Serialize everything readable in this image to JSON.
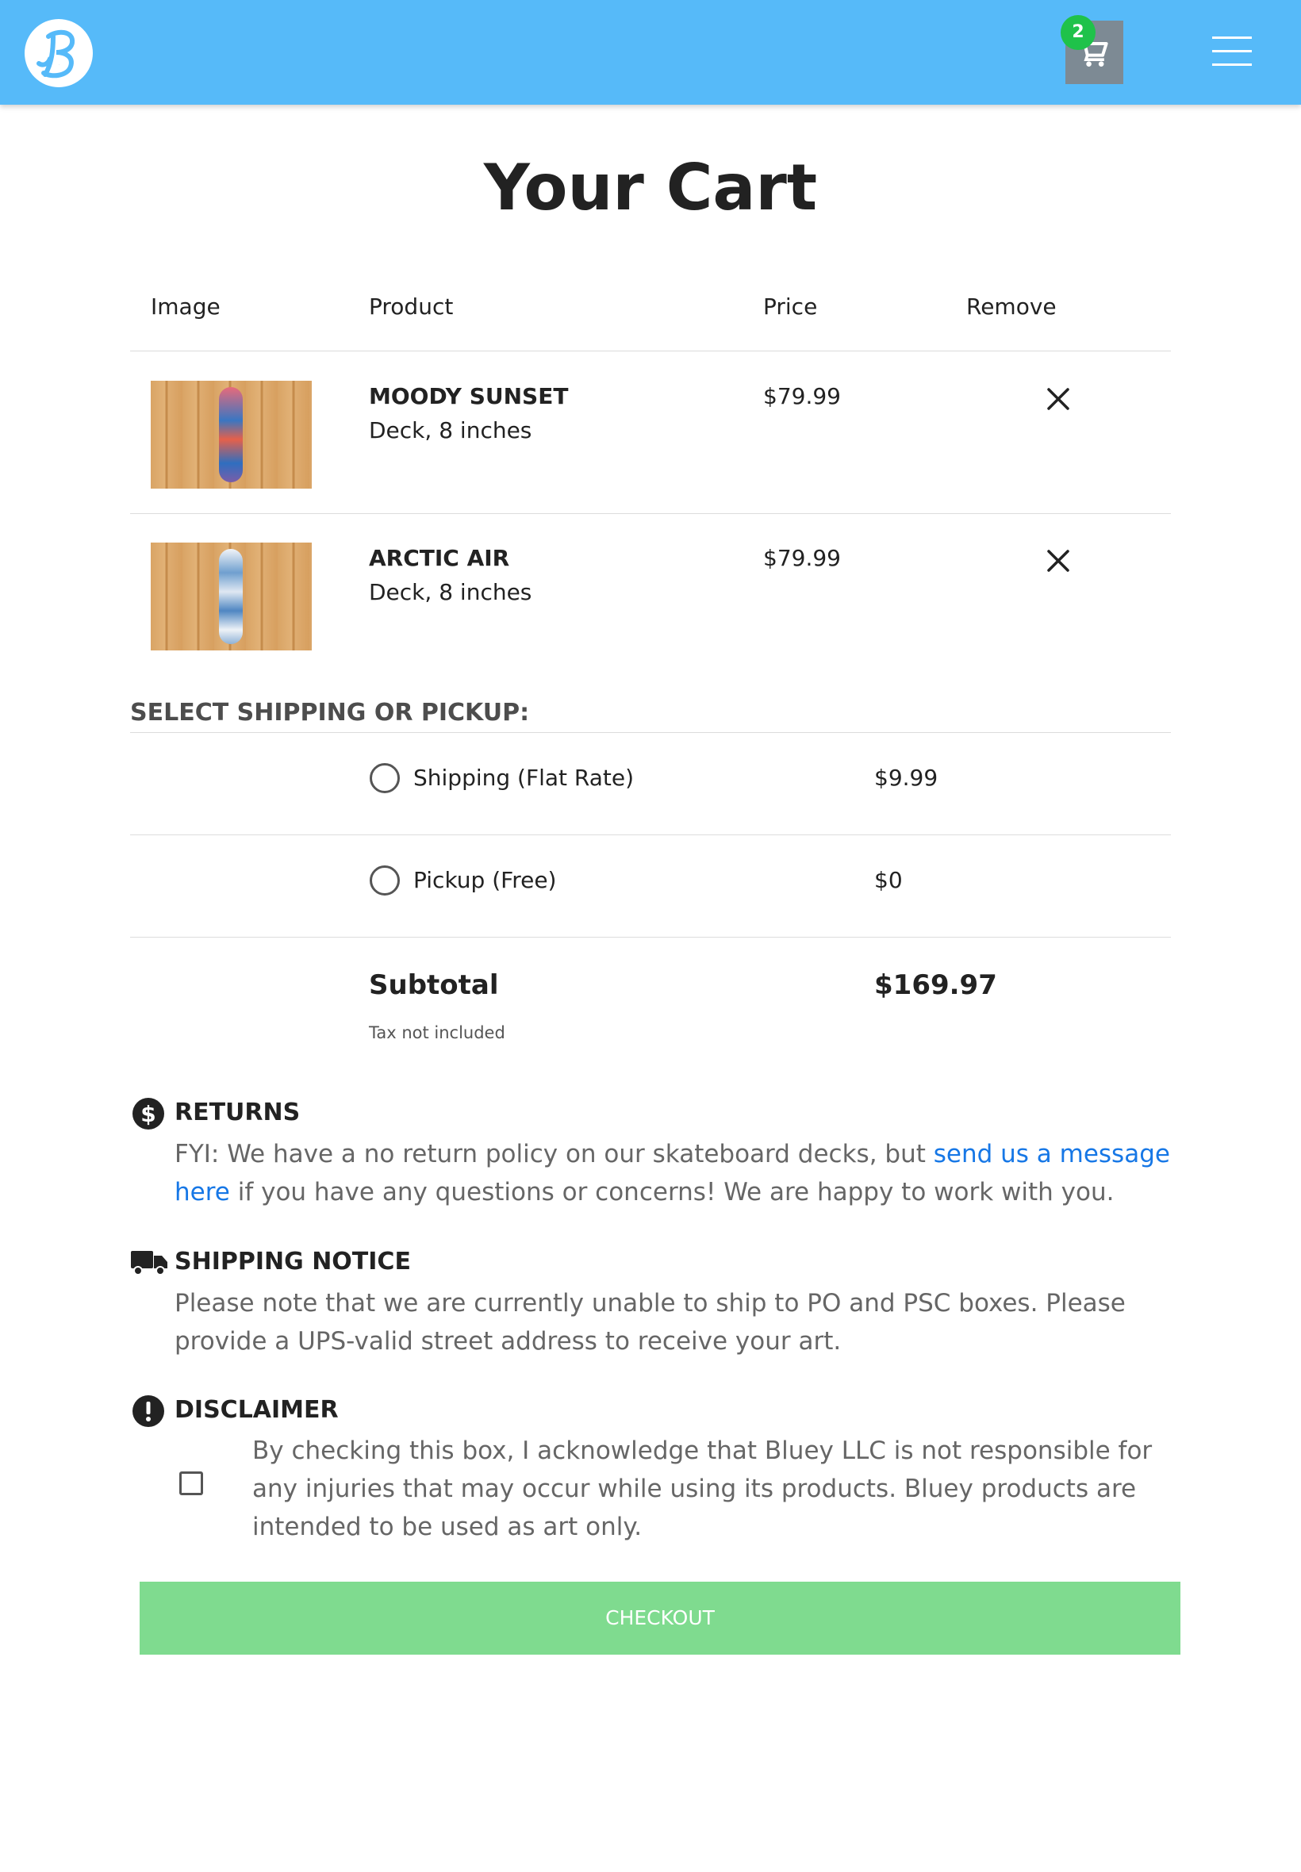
{
  "header": {
    "logo_letter": "B",
    "cart_count": "2",
    "colors": {
      "bar": "#56baf9",
      "cart_button": "#7d8a94",
      "badge": "#1fc24a"
    }
  },
  "page_title": "Your Cart",
  "table": {
    "headers": {
      "image": "Image",
      "product": "Product",
      "price": "Price",
      "remove": "Remove"
    },
    "items": [
      {
        "name": "MOODY SUNSET",
        "variant": "Deck, 8 inches",
        "price": "$79.99",
        "image_icon": "skateboard-deck-image"
      },
      {
        "name": "ARCTIC AIR",
        "variant": "Deck, 8 inches",
        "price": "$79.99",
        "image_icon": "skateboard-deck-image"
      }
    ]
  },
  "shipping": {
    "heading": "SELECT SHIPPING OR PICKUP:",
    "options": [
      {
        "label": "Shipping (Flat Rate)",
        "price": "$9.99",
        "selected": false
      },
      {
        "label": "Pickup (Free)",
        "price": "$0",
        "selected": false
      }
    ]
  },
  "subtotal": {
    "label": "Subtotal",
    "value": "$169.97",
    "tax_note": "Tax not included"
  },
  "notices": {
    "returns": {
      "icon": "dollar-icon",
      "title": "RETURNS",
      "body_before": "FYI: We have a no return policy on our skateboard decks, but ",
      "link": "send us a message here",
      "body_after": " if you have any questions or concerns! We are happy to work with you."
    },
    "shipping": {
      "icon": "truck-icon",
      "title": "SHIPPING NOTICE",
      "body": "Please note that we are currently unable to ship to PO and PSC boxes. Please provide a UPS-valid street address to receive your art."
    },
    "disclaimer": {
      "icon": "exclamation-icon",
      "title": "DISCLAIMER",
      "body": "By checking this box, I acknowledge that Bluey LLC is not responsible for any injuries that may occur while using its products. Bluey products are intended to be used as art only.",
      "checked": false
    }
  },
  "checkout": {
    "label": "CHECKOUT",
    "color": "#7fdb8f"
  }
}
